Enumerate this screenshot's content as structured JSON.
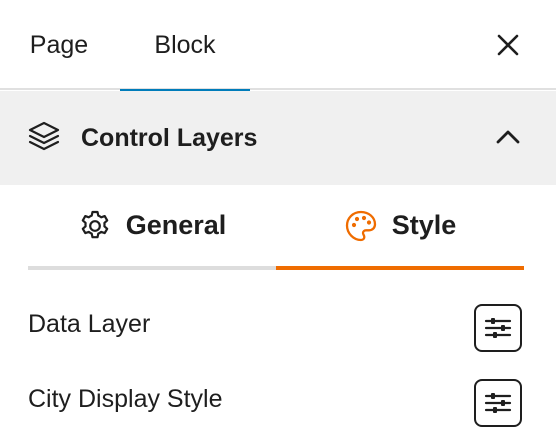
{
  "top_tabs": [
    {
      "label": "Page"
    },
    {
      "label": "Block"
    }
  ],
  "panel": {
    "title": "Control Layers",
    "icon": "layers-icon"
  },
  "subtabs": [
    {
      "label": "General",
      "icon": "gear-icon"
    },
    {
      "label": "Style",
      "icon": "palette-icon"
    }
  ],
  "settings": [
    {
      "label": "Data Layer",
      "icon": "sliders-icon"
    },
    {
      "label": "City Display Style",
      "icon": "sliders-icon"
    }
  ],
  "colors": {
    "accent_blue": "#007cba",
    "accent_orange": "#ef6c00",
    "header_bg": "#f0f0f0",
    "text": "#1e1e1e"
  }
}
